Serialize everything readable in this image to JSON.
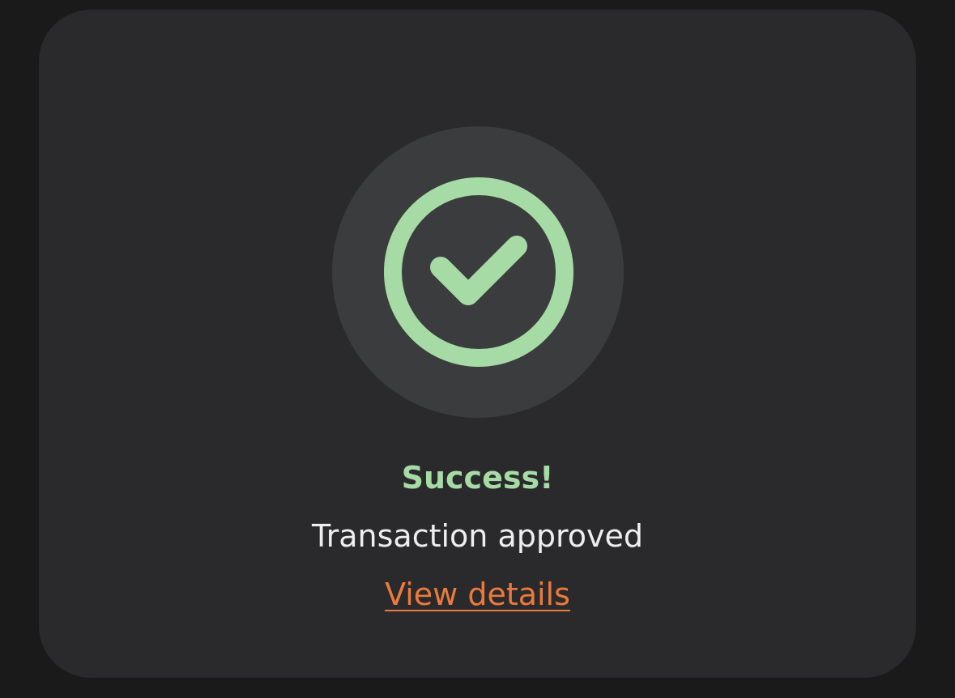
{
  "dialog": {
    "title": "Success!",
    "message": "Transaction approved",
    "link_label": "View details",
    "icon": "check-circle-icon"
  },
  "colors": {
    "page_bg": "#1a1a1b",
    "card_bg": "#2a2a2c",
    "icon_halo_bg": "#3b3c3e",
    "success_green": "#a6dba5",
    "message_text": "#eeeeef",
    "link_orange": "#ea7a3c"
  }
}
